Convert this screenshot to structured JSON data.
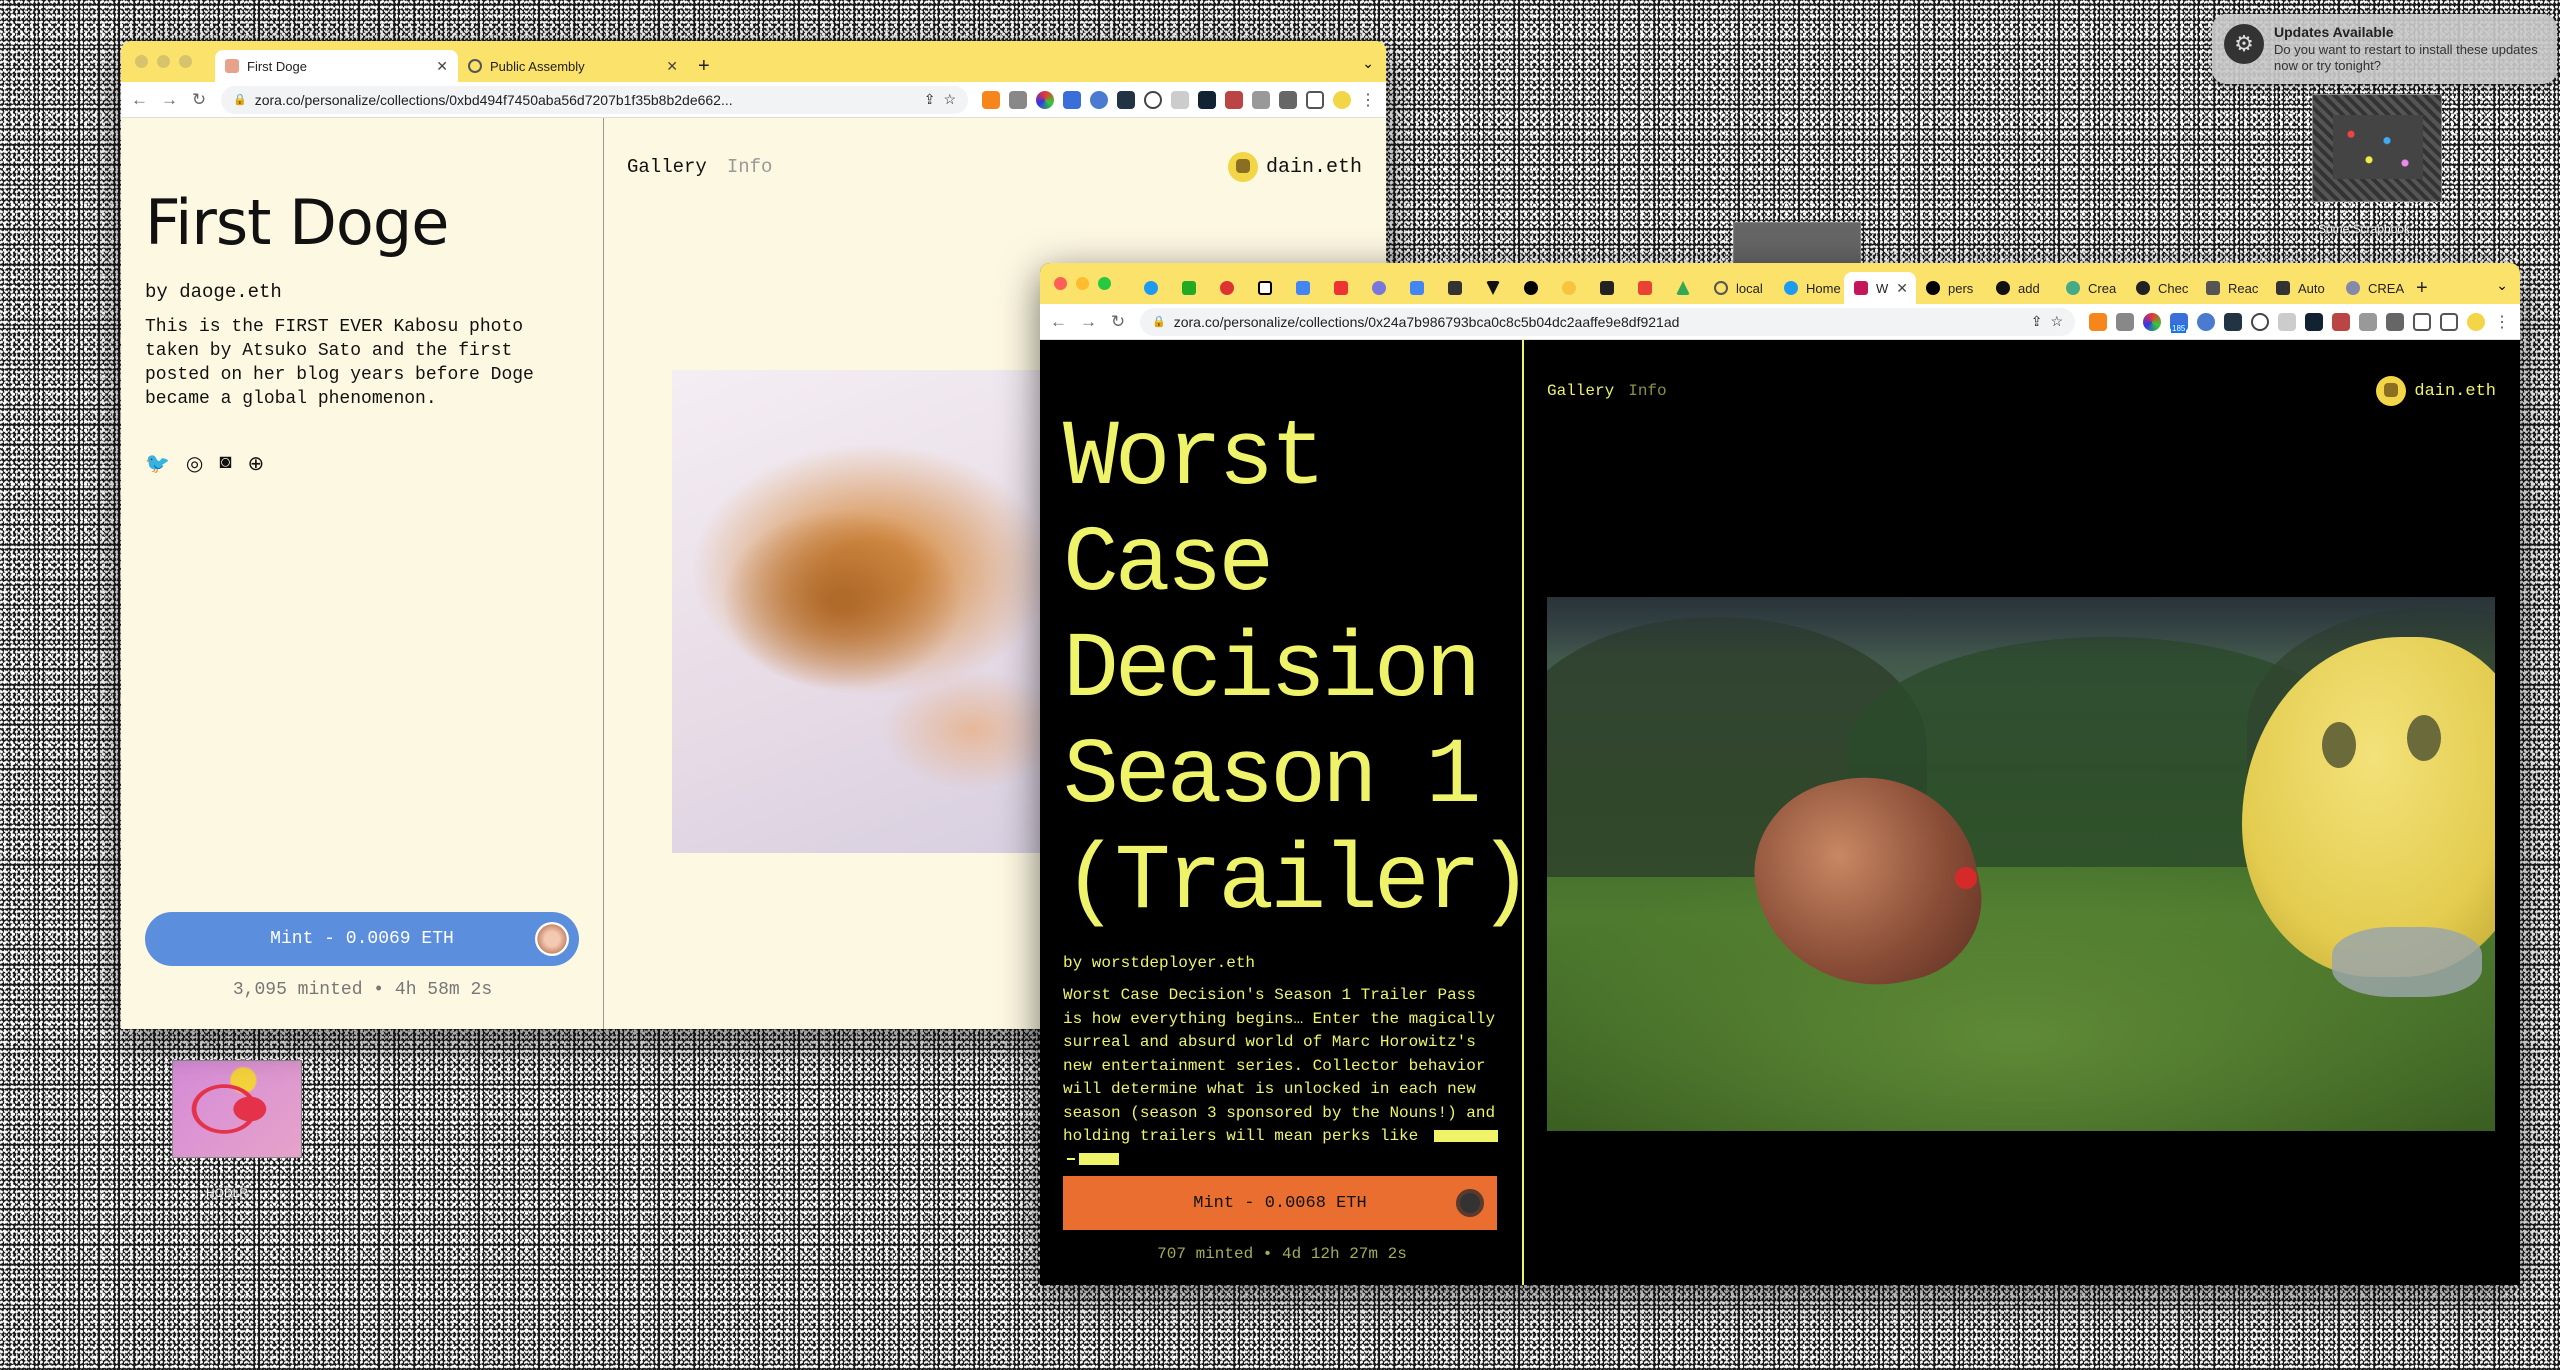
{
  "notification": {
    "title": "Updates Available",
    "body": "Do you want to restart to install these updates now or try tonight?"
  },
  "desktop": {
    "label_top_right": "Some Scrapbook",
    "label_bottom_left": "HODLR"
  },
  "window1": {
    "tabs": [
      {
        "label": "First Doge",
        "active": true
      },
      {
        "label": "Public Assembly",
        "active": false
      }
    ],
    "url": "zora.co/personalize/collections/0xbd494f7450aba56d7207b1f35b8b2de662...",
    "nav": {
      "gallery": "Gallery",
      "info": "Info"
    },
    "user": "dain.eth",
    "title": "First Doge",
    "by": "by daoge.eth",
    "description": "This is the FIRST EVER Kabosu photo taken by Atsuko Sato and the first posted on her blog years before Doge became a global phenomenon.",
    "mint_label": "Mint - 0.0069 ETH",
    "stats": "3,095 minted • 4h 58m 2s",
    "social_icons": [
      "twitter-icon",
      "instagram-icon",
      "discord-icon",
      "globe-icon"
    ],
    "accent": "#5b8fdd",
    "background": "#fdf8e2"
  },
  "window2": {
    "tabs": [
      "",
      "",
      "",
      "",
      "",
      "",
      "",
      "",
      "",
      "",
      "",
      "",
      "",
      "",
      "",
      "local",
      "Home",
      "W",
      "pers",
      "add",
      "Crea",
      "Chec",
      "Reac",
      "Auto",
      "CREA"
    ],
    "url": "zora.co/personalize/collections/0x24a7b986793bca0c8c5b04dc2aaffe9e8df921ad",
    "nav": {
      "gallery": "Gallery",
      "info": "Info"
    },
    "user": "dain.eth",
    "title": "Worst Case Decision Season 1 (Trailer)",
    "by": "by worstdeployer.eth",
    "description": "Worst Case Decision's Season 1 Trailer Pass is how everything begins… Enter the magically surreal and absurd world of Marc Horowitz's new entertainment series. Collector behavior will determine what is unlocked in each new season (season 3 sponsored by the Nouns!) and holding trailers will mean perks like",
    "mint_label": "Mint - 0.0068 ETH",
    "stats": "707 minted • 4d 12h 27m 2s",
    "accent": "#eef36a",
    "mint_color": "#ea6e2f",
    "extension_badge": "185"
  }
}
